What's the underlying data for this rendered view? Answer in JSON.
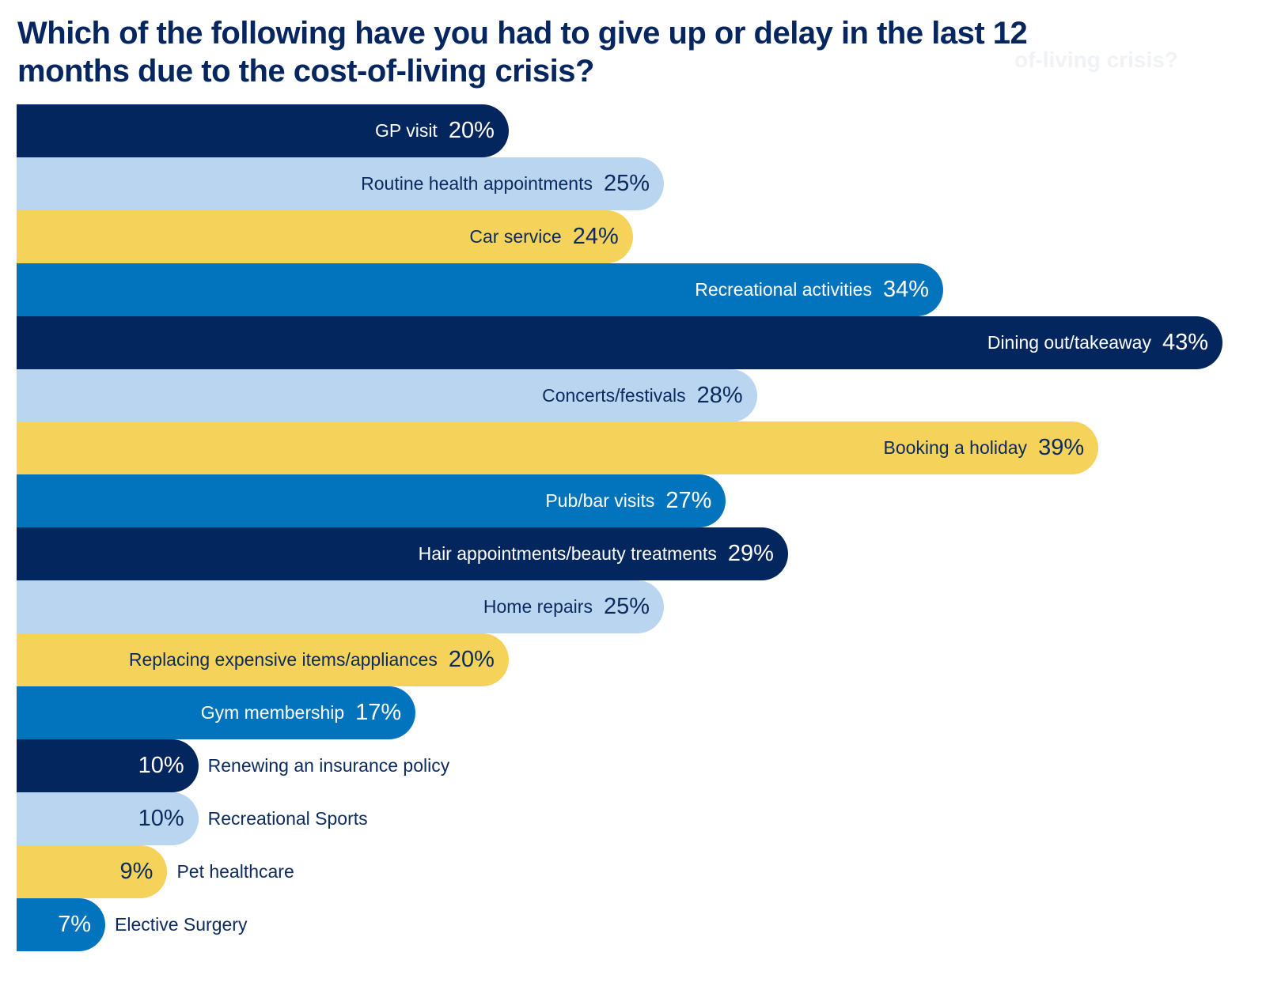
{
  "chart_data": {
    "type": "bar",
    "orientation": "horizontal",
    "title": "Which of the following have you had to give up or delay in the last 12 months due to the cost-of-living crisis?",
    "ghost_text": "of-living crisis?",
    "xlabel": "",
    "ylabel": "",
    "xlim": [
      0,
      43
    ],
    "grid": false,
    "legend": "none",
    "unit": "%",
    "categories": [
      "GP visit",
      "Routine  health appointments",
      "Car service",
      "Recreational activities",
      "Dining out/takeaway",
      "Concerts/festivals",
      "Booking a holiday",
      "Pub/bar visits",
      "Hair appointments/beauty treatments",
      "Home repairs",
      "Replacing expensive items/appliances",
      "Gym membership",
      "Renewing an insurance policy",
      "Recreational Sports",
      "Pet healthcare",
      "Elective Surgery"
    ],
    "values": [
      20,
      25,
      24,
      34,
      43,
      28,
      39,
      27,
      29,
      25,
      20,
      17,
      10,
      10,
      9,
      7
    ],
    "value_labels": [
      "20%",
      "25%",
      "24%",
      "34%",
      "43%",
      "28%",
      "39%",
      "27%",
      "29%",
      "25%",
      "20%",
      "17%",
      "10%",
      "10%",
      "9%",
      "7%"
    ],
    "bar_colors": [
      "#04265f",
      "#bad5ef",
      "#f5d35a",
      "#0274be",
      "#04265f",
      "#bad5ef",
      "#f5d35a",
      "#0274be",
      "#04265f",
      "#bad5ef",
      "#f5d35a",
      "#0274be",
      "#04265f",
      "#bad5ef",
      "#f5d35a",
      "#0274be"
    ],
    "text_colors": [
      "#ffffff",
      "#0b2a5e",
      "#0b2a5e",
      "#ffffff",
      "#ffffff",
      "#0b2a5e",
      "#0b2a5e",
      "#ffffff",
      "#ffffff",
      "#0b2a5e",
      "#0b2a5e",
      "#ffffff",
      "#ffffff",
      "#0b2a5e",
      "#0b2a5e",
      "#ffffff"
    ],
    "label_position": [
      "inside",
      "inside",
      "inside",
      "inside",
      "inside",
      "inside",
      "inside",
      "inside",
      "inside",
      "inside",
      "inside",
      "inside",
      "outside",
      "outside",
      "outside",
      "outside"
    ]
  }
}
